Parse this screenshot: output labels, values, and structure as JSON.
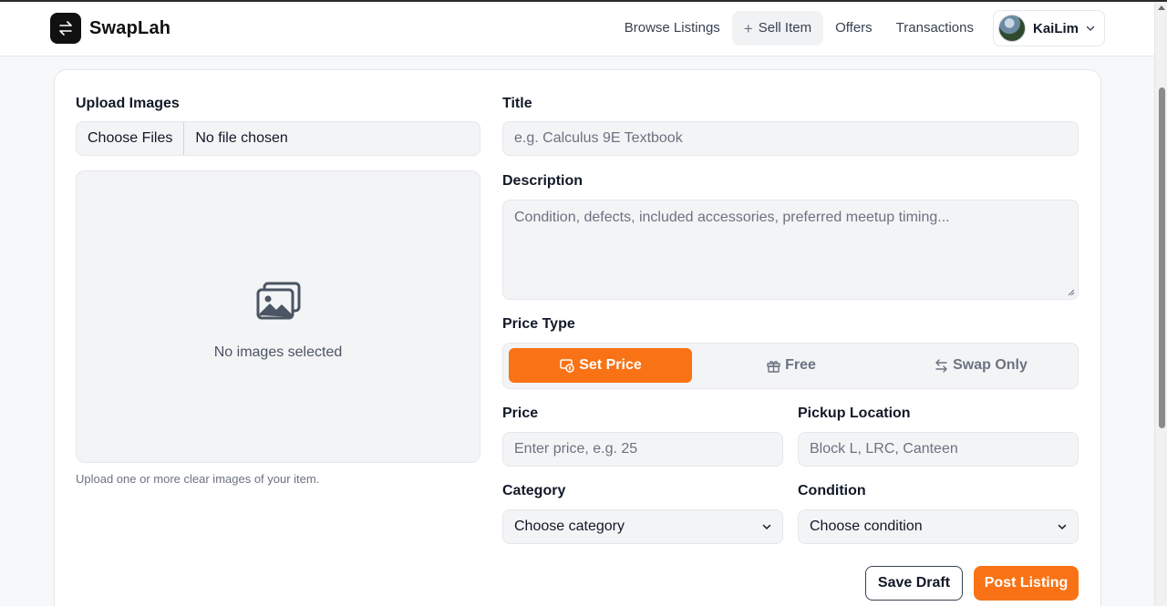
{
  "app": {
    "name": "SwapLah",
    "logo_icon": "swap-arrows-icon"
  },
  "nav": {
    "links": [
      {
        "label": "Browse Listings",
        "active": false
      },
      {
        "label": "Sell Item",
        "active": true,
        "icon": "plus-icon"
      },
      {
        "label": "Offers",
        "active": false
      },
      {
        "label": "Transactions",
        "active": false
      }
    ],
    "user": {
      "name": "KaiLim",
      "icon": "chevron-down-icon"
    }
  },
  "form": {
    "upload": {
      "label": "Upload Images",
      "button": "Choose Files",
      "status": "No file chosen",
      "empty_text": "No images selected",
      "hint": "Upload one or more clear images of your item.",
      "icon": "images-icon"
    },
    "title": {
      "label": "Title",
      "placeholder": "e.g. Calculus 9E Textbook"
    },
    "description": {
      "label": "Description",
      "placeholder": "Condition, defects, included accessories, preferred meetup timing..."
    },
    "price_type": {
      "label": "Price Type",
      "options": [
        {
          "label": "Set Price",
          "icon": "price-tag-icon",
          "selected": true
        },
        {
          "label": "Free",
          "icon": "gift-icon",
          "selected": false
        },
        {
          "label": "Swap Only",
          "icon": "swap-icon",
          "selected": false
        }
      ]
    },
    "price": {
      "label": "Price",
      "placeholder": "Enter price, e.g. 25"
    },
    "pickup": {
      "label": "Pickup Location",
      "placeholder": "Block L, LRC, Canteen"
    },
    "category": {
      "label": "Category",
      "value": "Choose category"
    },
    "condition": {
      "label": "Condition",
      "value": "Choose condition"
    },
    "actions": {
      "save_draft": "Save Draft",
      "post": "Post Listing"
    }
  },
  "colors": {
    "accent": "#f97316",
    "field_bg": "#f3f4f6",
    "text": "#111827",
    "muted": "#6b7280"
  }
}
